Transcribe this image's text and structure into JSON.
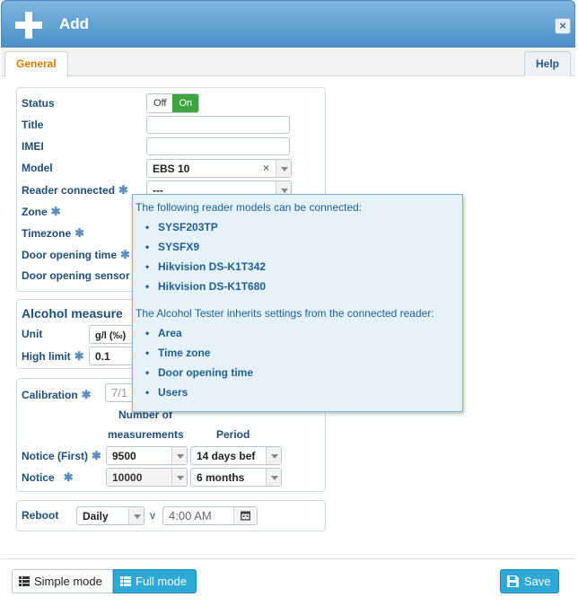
{
  "dialog": {
    "title": "Add",
    "close_label": "×"
  },
  "tabs": {
    "general": "General",
    "help": "Help"
  },
  "form": {
    "status": {
      "label": "Status",
      "off": "Off",
      "on": "On",
      "value": "On"
    },
    "title": {
      "label": "Title",
      "value": ""
    },
    "imei": {
      "label": "IMEI",
      "value": ""
    },
    "model": {
      "label": "Model",
      "value": "EBS 10",
      "clear": "×"
    },
    "reader": {
      "label": "Reader connected",
      "star": "✱",
      "value": "---"
    },
    "zone": {
      "label": "Zone",
      "star": "✱"
    },
    "timezone": {
      "label": "Timezone",
      "star": "✱"
    },
    "door_time": {
      "label": "Door opening time",
      "star": "✱"
    },
    "door_sensor": {
      "label": "Door opening sensor"
    }
  },
  "alcohol": {
    "title": "Alcohol measure",
    "unit": {
      "label": "Unit",
      "value": "g/l (‰)"
    },
    "high_limit": {
      "label": "High limit",
      "star": "✱",
      "value": "0.1"
    }
  },
  "calibration": {
    "label": "Calibration",
    "star": "✱",
    "date_value": "7/1",
    "col_measurements_1": "Number of",
    "col_measurements_2": "measurements",
    "col_period": "Period",
    "notice_first": {
      "label": "Notice (First)",
      "star": "✱",
      "measurements": "9500",
      "period": "14 days bef"
    },
    "notice": {
      "label": "Notice",
      "star": "✱",
      "measurements": "10000",
      "period": "6 months"
    }
  },
  "reboot": {
    "label": "Reboot",
    "frequency": "Daily",
    "separator": "v",
    "time": "4:00 AM"
  },
  "tooltip": {
    "intro": "The following reader models can be connected:",
    "models": [
      "SYSF203TP",
      "SYSFX9",
      "Hikvision DS-K1T342",
      "Hikvision DS-K1T680"
    ],
    "inherit_intro": "The Alcohol Tester inherits settings from the connected reader:",
    "inherited": [
      "Area",
      "Time zone",
      "Door opening time",
      "Users"
    ]
  },
  "footer": {
    "simple_mode": "Simple mode",
    "full_mode": "Full mode",
    "save": "Save"
  },
  "colors": {
    "accent": "#2ea8d5",
    "toggle_on": "#3fa33f",
    "label": "#1f4e79",
    "tab_active": "#e07b00"
  },
  "icons": {
    "title": "plus-icon",
    "close": "close-icon",
    "calendar": "calendar-icon",
    "save": "floppy-disk-icon",
    "list": "list-icon"
  }
}
